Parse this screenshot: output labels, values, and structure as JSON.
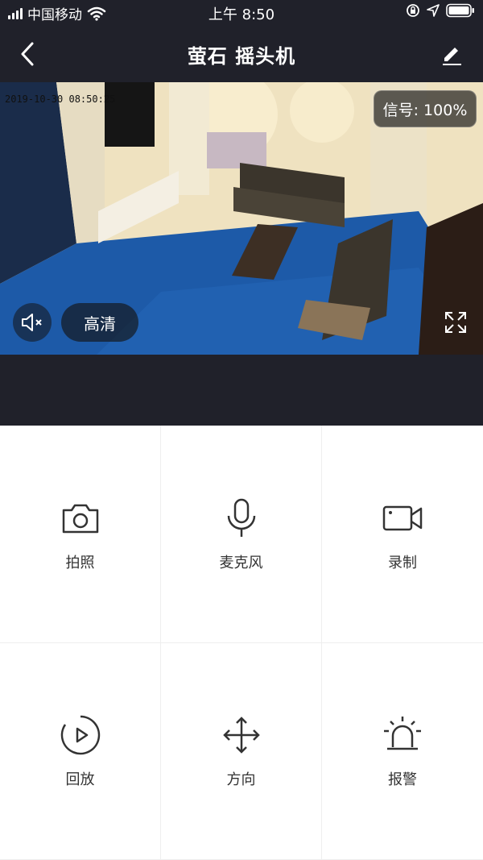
{
  "status_bar": {
    "carrier": "中国移动",
    "time": "上午 8:50"
  },
  "nav": {
    "title": "萤石 摇头机"
  },
  "video": {
    "timestamp": "2019-10-30 08:50:25",
    "signal": "信号: 100%",
    "quality": "高清"
  },
  "controls": [
    {
      "label": "拍照",
      "icon": "camera-icon"
    },
    {
      "label": "麦克风",
      "icon": "microphone-icon"
    },
    {
      "label": "录制",
      "icon": "video-record-icon"
    },
    {
      "label": "回放",
      "icon": "playback-icon"
    },
    {
      "label": "方向",
      "icon": "direction-arrows-icon"
    },
    {
      "label": "报警",
      "icon": "alarm-siren-icon"
    }
  ]
}
